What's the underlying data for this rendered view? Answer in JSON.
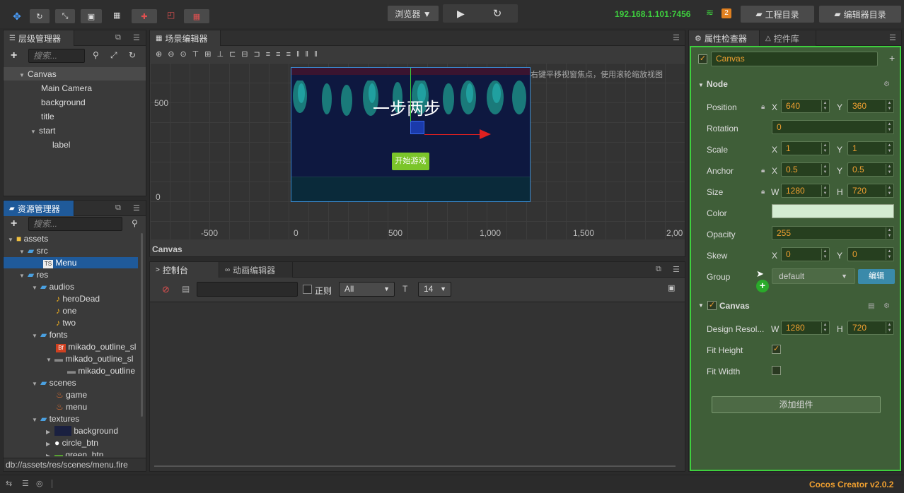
{
  "topbar": {
    "browser_label": "浏览器 ▼",
    "ip": "192.168.1.101:7456",
    "notify_count": "2",
    "project_btn": "工程目录",
    "editor_btn": "编辑器目录"
  },
  "hierarchy": {
    "title": "层级管理器",
    "search_placeholder": "搜索...",
    "items": [
      {
        "label": "Canvas"
      },
      {
        "label": "Main Camera"
      },
      {
        "label": "background"
      },
      {
        "label": "title"
      },
      {
        "label": "start"
      },
      {
        "label": "label"
      }
    ]
  },
  "assets": {
    "title": "资源管理器",
    "search_placeholder": "搜索...",
    "items": [
      {
        "label": "assets"
      },
      {
        "label": "src"
      },
      {
        "label": "Menu"
      },
      {
        "label": "res"
      },
      {
        "label": "audios"
      },
      {
        "label": "heroDead"
      },
      {
        "label": "one"
      },
      {
        "label": "two"
      },
      {
        "label": "fonts"
      },
      {
        "label": "mikado_outline_sl"
      },
      {
        "label": "mikado_outline_sl"
      },
      {
        "label": "mikado_outline"
      },
      {
        "label": "scenes"
      },
      {
        "label": "game"
      },
      {
        "label": "menu"
      },
      {
        "label": "textures"
      },
      {
        "label": "background"
      },
      {
        "label": "circle_btn"
      },
      {
        "label": "green_btn"
      }
    ],
    "ts_badge": "TS",
    "bf_badge": "Bf",
    "path": "db://assets/res/scenes/menu.fire"
  },
  "scene": {
    "title": "场景编辑器",
    "hint": "使用鼠标右键平移视窗焦点，使用滚轮缩放视图",
    "game_title": "一步两步",
    "start_btn": "开始游戏",
    "y_labels": [
      "500",
      "0"
    ],
    "x_labels": [
      "-500",
      "0",
      "500",
      "1,000",
      "1,500",
      "2,00"
    ],
    "breadcrumb": "Canvas"
  },
  "console": {
    "tab_console": "控制台",
    "tab_anim": "动画编辑器",
    "regex_label": "正则",
    "filter_value": "All",
    "font_size": "14"
  },
  "inspector": {
    "tab_props": "属性检查器",
    "tab_widgets": "控件库",
    "node_name": "Canvas",
    "section_node": "Node",
    "rows": {
      "position": {
        "label": "Position",
        "x": "640",
        "y": "360"
      },
      "rotation": {
        "label": "Rotation",
        "value": "0"
      },
      "scale": {
        "label": "Scale",
        "x": "1",
        "y": "1"
      },
      "anchor": {
        "label": "Anchor",
        "x": "0.5",
        "y": "0.5"
      },
      "size": {
        "label": "Size",
        "w": "1280",
        "h": "720"
      },
      "color": {
        "label": "Color",
        "value": "#d4ecd2"
      },
      "opacity": {
        "label": "Opacity",
        "value": "255"
      },
      "skew": {
        "label": "Skew",
        "x": "0",
        "y": "0"
      },
      "group": {
        "label": "Group",
        "value": "default",
        "edit": "编辑"
      }
    },
    "axis": {
      "x": "X",
      "y": "Y",
      "w": "W",
      "h": "H"
    },
    "section_canvas": "Canvas",
    "design_res": {
      "label": "Design Resol...",
      "w": "1280",
      "h": "720"
    },
    "fit_height": {
      "label": "Fit Height",
      "checked": true
    },
    "fit_width": {
      "label": "Fit Width",
      "checked": false
    },
    "add_component": "添加组件"
  },
  "status": {
    "version": "Cocos Creator v2.0.2"
  },
  "colors": {
    "accent_green": "#3ecf3e",
    "inspector_bg": "#3f5e38",
    "value_orange": "#f0a030",
    "version_orange": "#f0a030"
  }
}
